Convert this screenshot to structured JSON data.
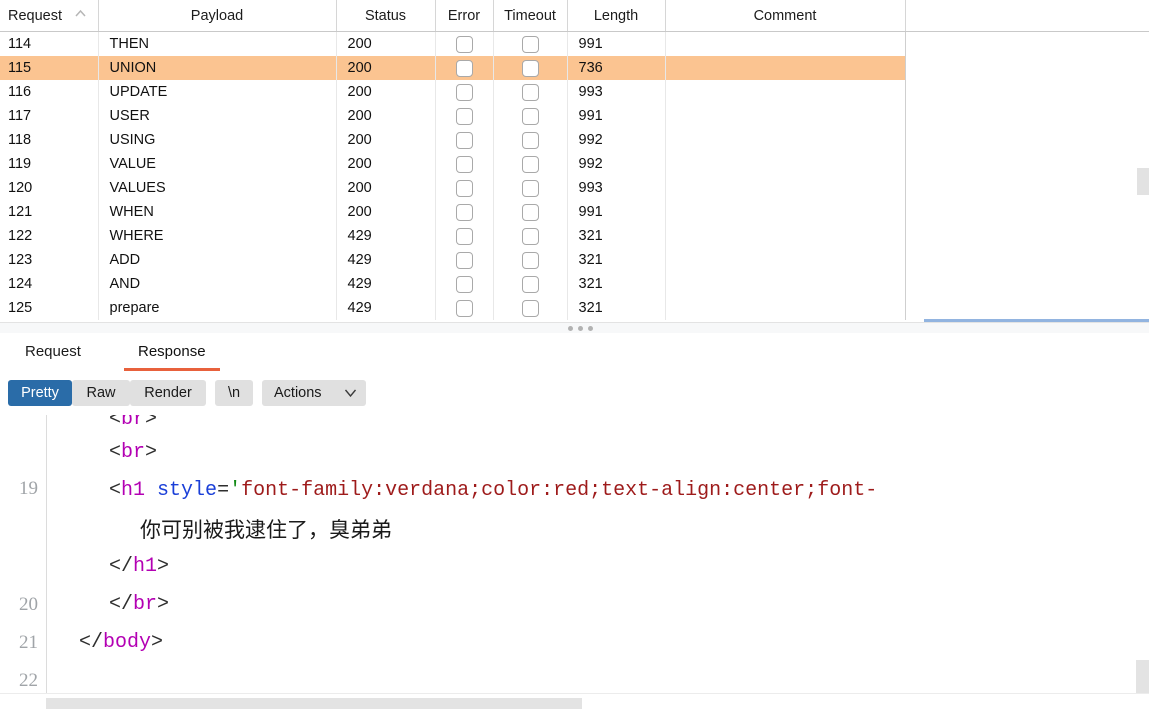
{
  "results_table": {
    "columns": [
      {
        "key": "request",
        "label": "Request",
        "sort_icon": "chevron-up-icon"
      },
      {
        "key": "payload",
        "label": "Payload"
      },
      {
        "key": "status",
        "label": "Status"
      },
      {
        "key": "error",
        "label": "Error"
      },
      {
        "key": "timeout",
        "label": "Timeout"
      },
      {
        "key": "length",
        "label": "Length"
      },
      {
        "key": "comment",
        "label": "Comment"
      }
    ],
    "rows": [
      {
        "request": "114",
        "payload": "THEN",
        "status": "200",
        "error": false,
        "timeout": false,
        "length": "991",
        "comment": "",
        "selected": false
      },
      {
        "request": "115",
        "payload": "UNION",
        "status": "200",
        "error": false,
        "timeout": false,
        "length": "736",
        "comment": "",
        "selected": true
      },
      {
        "request": "116",
        "payload": "UPDATE",
        "status": "200",
        "error": false,
        "timeout": false,
        "length": "993",
        "comment": "",
        "selected": false
      },
      {
        "request": "117",
        "payload": "USER",
        "status": "200",
        "error": false,
        "timeout": false,
        "length": "991",
        "comment": "",
        "selected": false
      },
      {
        "request": "118",
        "payload": "USING",
        "status": "200",
        "error": false,
        "timeout": false,
        "length": "992",
        "comment": "",
        "selected": false
      },
      {
        "request": "119",
        "payload": "VALUE",
        "status": "200",
        "error": false,
        "timeout": false,
        "length": "992",
        "comment": "",
        "selected": false
      },
      {
        "request": "120",
        "payload": "VALUES",
        "status": "200",
        "error": false,
        "timeout": false,
        "length": "993",
        "comment": "",
        "selected": false
      },
      {
        "request": "121",
        "payload": "WHEN",
        "status": "200",
        "error": false,
        "timeout": false,
        "length": "991",
        "comment": "",
        "selected": false
      },
      {
        "request": "122",
        "payload": "WHERE",
        "status": "429",
        "error": false,
        "timeout": false,
        "length": "321",
        "comment": "",
        "selected": false
      },
      {
        "request": "123",
        "payload": "ADD",
        "status": "429",
        "error": false,
        "timeout": false,
        "length": "321",
        "comment": "",
        "selected": false
      },
      {
        "request": "124",
        "payload": "AND",
        "status": "429",
        "error": false,
        "timeout": false,
        "length": "321",
        "comment": "",
        "selected": false
      },
      {
        "request": "125",
        "payload": "prepare",
        "status": "429",
        "error": false,
        "timeout": false,
        "length": "321",
        "comment": "",
        "selected": false
      }
    ],
    "selected_row_color": "#fbc491"
  },
  "detail_tabs": {
    "request_label": "Request",
    "response_label": "Response",
    "active": "Response",
    "active_underline_color": "#e8613c"
  },
  "toolbar": {
    "pretty_label": "Pretty",
    "raw_label": "Raw",
    "render_label": "Render",
    "newline_label": "\\n",
    "actions_label": "Actions",
    "actions_caret_icon": "chevron-down-icon",
    "active_button": "Pretty",
    "active_button_color": "#2a6ca8"
  },
  "editor": {
    "line_numbers": [
      "19",
      "20",
      "21",
      "22"
    ],
    "lines": [
      {
        "number": "",
        "tokens": [
          {
            "t": "<",
            "c": "punct"
          },
          {
            "t": "br",
            "c": "tag"
          },
          {
            "t": ">",
            "c": "punct"
          }
        ],
        "clipped_top": true
      },
      {
        "number": "",
        "tokens": [
          {
            "t": "<",
            "c": "punct"
          },
          {
            "t": "br",
            "c": "tag"
          },
          {
            "t": ">",
            "c": "punct"
          }
        ]
      },
      {
        "number": "19",
        "tokens": [
          {
            "t": "<",
            "c": "punct"
          },
          {
            "t": "h1",
            "c": "tag"
          },
          {
            "t": " ",
            "c": "punct"
          },
          {
            "t": "style",
            "c": "attr"
          },
          {
            "t": "=",
            "c": "eq"
          },
          {
            "t": "'",
            "c": "quote"
          },
          {
            "t": "font-family:verdana;color:red;text-align:center;font-",
            "c": "str"
          }
        ]
      },
      {
        "number": "",
        "chinese": "你可别被我逮住了，臭弟弟"
      },
      {
        "number": "",
        "tokens": [
          {
            "t": "</",
            "c": "punct"
          },
          {
            "t": "h1",
            "c": "tag"
          },
          {
            "t": ">",
            "c": "punct"
          }
        ]
      },
      {
        "number": "20",
        "tokens": [
          {
            "t": "</",
            "c": "punct"
          },
          {
            "t": "br",
            "c": "tag"
          },
          {
            "t": ">",
            "c": "punct"
          }
        ]
      },
      {
        "number": "21",
        "tokens": [
          {
            "t": "</",
            "c": "punct"
          },
          {
            "t": "body",
            "c": "tag"
          },
          {
            "t": ">",
            "c": "punct"
          }
        ]
      },
      {
        "number": "22",
        "tokens": []
      }
    ],
    "syntax_colors": {
      "tag": "#b300b3",
      "attribute": "#1a3fd8",
      "string": "#9e1b1b",
      "quote": "#128a16",
      "punctuation": "#2e2e2e",
      "line_number": "#a0a4a8"
    }
  },
  "code_text": {
    "l18a": "<br>",
    "l18b": "<br>",
    "l19_open": "<",
    "l19_tag": "h1",
    "l19_attr": "style",
    "l19_eq": "=",
    "l19_quote": "'",
    "l19_value": "font-family:verdana;color:red;text-align:center;font-",
    "l19_chinese": "你可别被我逮住了，臭弟弟",
    "l19_close_open": "</",
    "l19_close_tag": "h1",
    "l19_close_gt": ">",
    "l20_open": "</",
    "l20_tag": "br",
    "l20_gt": ">",
    "l21_open": "</",
    "l21_tag": "body",
    "l21_gt": ">"
  },
  "scrollbars": {
    "results_vertical": "scrollbar-thumb",
    "editor_vertical": "scrollbar-thumb",
    "editor_horizontal": "scrollbar-thumb"
  },
  "splitter": {
    "handle_icon": "drag-dots-icon"
  }
}
